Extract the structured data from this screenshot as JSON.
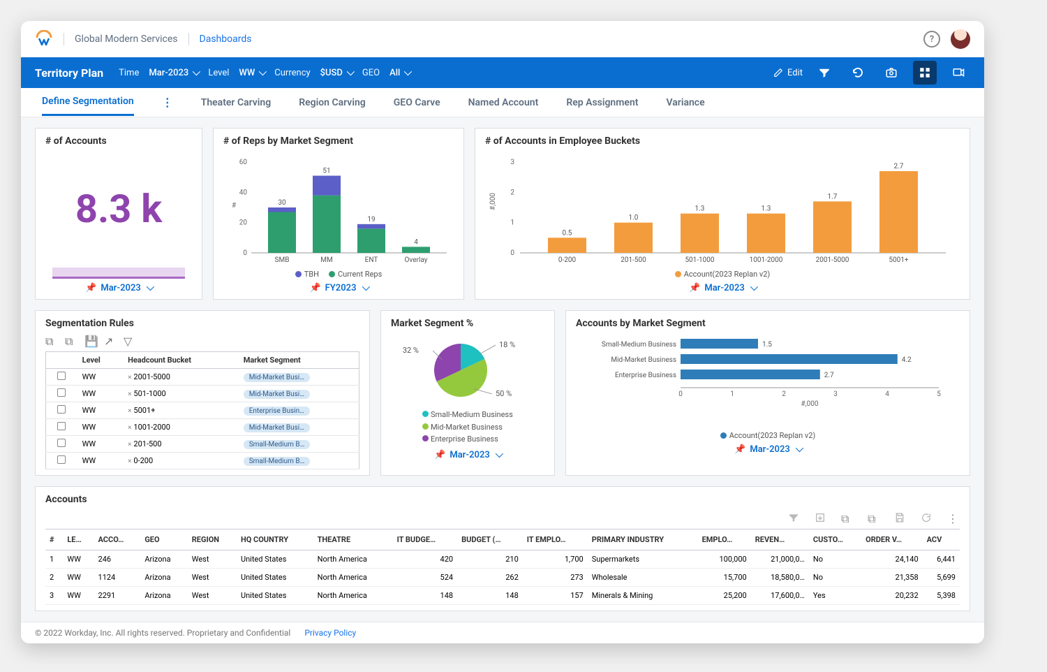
{
  "breadcrumb": {
    "company": "Global Modern Services",
    "page": "Dashboards"
  },
  "title": "Territory Plan",
  "filters": {
    "time_label": "Time",
    "time_value": "Mar-2023",
    "level_label": "Level",
    "level_value": "WW",
    "currency_label": "Currency",
    "currency_value": "$USD",
    "geo_label": "GEO",
    "geo_value": "All"
  },
  "edit_label": "Edit",
  "tabs": [
    "Define Segmentation",
    "Theater Carving",
    "Region Carving",
    "GEO Carve",
    "Named Account",
    "Rep Assignment",
    "Variance"
  ],
  "cards": {
    "accounts": {
      "title": "# of Accounts",
      "value": "8.3 k",
      "pin": "Mar-2023"
    },
    "reps": {
      "title": "# of Reps by Market Segment",
      "pin": "FY2023",
      "legend": [
        "TBH",
        "Current Reps"
      ]
    },
    "buckets": {
      "title": "# of Accounts in Employee Buckets",
      "pin": "Mar-2023",
      "legend": "Account(2023 Replan v2)"
    },
    "segrules": {
      "title": "Segmentation Rules",
      "cols": [
        "Level",
        "Headcount Bucket",
        "Market Segment"
      ]
    },
    "pie": {
      "title": "Market Segment %",
      "pin": "Mar-2023",
      "legend": [
        "Small-Medium Business",
        "Mid-Market Business",
        "Enterprise Business"
      ]
    },
    "hbar": {
      "title": "Accounts by Market Segment",
      "pin": "Mar-2023",
      "legend": "Account(2023 Replan v2)",
      "xlabel": "#,000"
    },
    "accts": {
      "title": "Accounts",
      "cols": [
        "#",
        "LE…",
        "ACCO…",
        "GEO",
        "REGION",
        "HQ COUNTRY",
        "THEATRE",
        "IT BUDGE…",
        "BUDGET (…",
        "IT EMPLO…",
        "PRIMARY INDUSTRY",
        "EMPLO…",
        "REVEN…",
        "CUSTO…",
        "ORDER V…",
        "ACV"
      ]
    }
  },
  "chart_data": [
    {
      "type": "bar",
      "stacked": true,
      "id": "reps",
      "title": "# of Reps by Market Segment",
      "categories": [
        "SMB",
        "MM",
        "ENT",
        "Overlay"
      ],
      "series": [
        {
          "name": "Current Reps",
          "values": [
            27,
            38,
            16,
            4
          ],
          "color": "#2e9e6f"
        },
        {
          "name": "TBH",
          "values": [
            3,
            13,
            3,
            0
          ],
          "color": "#5b5fc7"
        }
      ],
      "totals": [
        30,
        51,
        19,
        4
      ],
      "ylabel": "#",
      "ylim": [
        0,
        60
      ],
      "yticks": [
        0,
        20,
        40,
        60
      ]
    },
    {
      "type": "bar",
      "id": "buckets",
      "title": "# of Accounts in Employee Buckets",
      "categories": [
        "0-200",
        "201-500",
        "501-1000",
        "1001-2000",
        "2001-5000",
        "5001+"
      ],
      "values": [
        0.5,
        1.0,
        1.3,
        1.3,
        1.7,
        2.7
      ],
      "ylabel": "#,000",
      "ylim": [
        0,
        3
      ],
      "yticks": [
        0,
        1,
        2,
        3
      ],
      "color": "#f39c3e",
      "legend": "Account(2023 Replan v2)"
    },
    {
      "type": "pie",
      "id": "segment_pct",
      "title": "Market Segment %",
      "slices": [
        {
          "name": "Small-Medium Business",
          "value": 18,
          "color": "#1ec0c0"
        },
        {
          "name": "Mid-Market Business",
          "value": 50,
          "color": "#95c93d"
        },
        {
          "name": "Enterprise Business",
          "value": 32,
          "color": "#8e44ad"
        }
      ]
    },
    {
      "type": "bar",
      "orientation": "horizontal",
      "id": "accounts_by_segment",
      "title": "Accounts by Market Segment",
      "categories": [
        "Small-Medium Business",
        "Mid-Market Business",
        "Enterprise Business"
      ],
      "values": [
        1.5,
        4.2,
        2.7
      ],
      "xlabel": "#,000",
      "xlim": [
        0,
        5
      ],
      "xticks": [
        0,
        1,
        2,
        3,
        4,
        5
      ],
      "color": "#2f7db8",
      "legend": "Account(2023 Replan v2)"
    }
  ],
  "segrules_rows": [
    {
      "level": "WW",
      "bucket": "2001-5000",
      "segment": "Mid-Market Busi…"
    },
    {
      "level": "WW",
      "bucket": "501-1000",
      "segment": "Mid-Market Busi…"
    },
    {
      "level": "WW",
      "bucket": "5001+",
      "segment": "Enterprise Busin…"
    },
    {
      "level": "WW",
      "bucket": "1001-2000",
      "segment": "Mid-Market Busi…"
    },
    {
      "level": "WW",
      "bucket": "201-500",
      "segment": "Small-Medium B…"
    },
    {
      "level": "WW",
      "bucket": "0-200",
      "segment": "Small-Medium B…"
    }
  ],
  "account_rows": [
    {
      "n": 1,
      "le": "WW",
      "acc": "246",
      "geo": "Arizona",
      "region": "West",
      "hq": "United States",
      "theatre": "North America",
      "itb": "420",
      "bud": "210",
      "ite": "1,700",
      "ind": "Supermarkets",
      "emp": "100,000",
      "rev": "21,000,0…",
      "cust": "No",
      "ord": "24,140",
      "acv": "6,441"
    },
    {
      "n": 2,
      "le": "WW",
      "acc": "1124",
      "geo": "Arizona",
      "region": "West",
      "hq": "United States",
      "theatre": "North America",
      "itb": "524",
      "bud": "262",
      "ite": "273",
      "ind": "Wholesale",
      "emp": "15,700",
      "rev": "18,580,0…",
      "cust": "No",
      "ord": "21,358",
      "acv": "5,699"
    },
    {
      "n": 3,
      "le": "WW",
      "acc": "2291",
      "geo": "Arizona",
      "region": "West",
      "hq": "United States",
      "theatre": "North America",
      "itb": "148",
      "bud": "148",
      "ite": "157",
      "ind": "Minerals & Mining",
      "emp": "25,200",
      "rev": "17,600,0…",
      "cust": "Yes",
      "ord": "20,232",
      "acv": "5,398"
    }
  ],
  "footer": {
    "copyright": "© 2022 Workday, Inc. All rights reserved. Proprietary and Confidential",
    "link": "Privacy Policy"
  }
}
